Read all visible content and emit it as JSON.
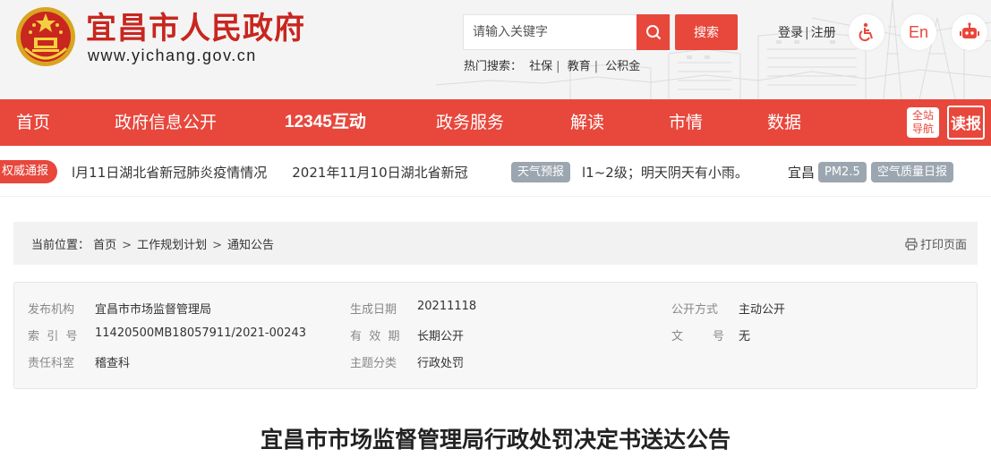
{
  "header": {
    "site_title": "宜昌市人民政府",
    "site_url": "www.yichang.gov.cn",
    "search_placeholder": "请输入关键字",
    "search_button": "搜索",
    "hot_label": "热门搜索：",
    "hot_terms": [
      "社保",
      "教育",
      "公积金"
    ],
    "login": "登录",
    "register": "注册",
    "lang_button": "En"
  },
  "nav": {
    "items": [
      "首页",
      "政府信息公开",
      "12345互动",
      "政务服务",
      "解读",
      "市情",
      "数据"
    ],
    "guide_line1": "全站",
    "guide_line2": "导航",
    "read_label": "读报"
  },
  "ticker": {
    "badge": "权威通报",
    "news": [
      "1月11日湖北省新冠肺炎疫情情况",
      "2021年11月10日湖北省新冠"
    ],
    "news_visible": [
      "l月11日湖北省新冠肺炎疫情情况",
      "2021年11月10日湖北省新冠"
    ],
    "weather_badge": "天气预报",
    "weather_text": "l1~2级；明天阴天有小雨。",
    "city_text": "宜昌",
    "pm_badge": "PM2.5",
    "aqi_badge": "空气质量日报"
  },
  "breadcrumb": {
    "prefix": "当前位置：",
    "items": [
      "首页",
      "工作规划计划",
      "通知公告"
    ],
    "separator": ">",
    "print_label": "打印页面"
  },
  "meta": {
    "publisher_label": "发布机构",
    "publisher": "宜昌市市场监督管理局",
    "date_label": "生成日期",
    "date": "20211118",
    "method_label": "公开方式",
    "method": "主动公开",
    "index_label": "索  引  号",
    "index": "11420500MB18057911/2021-00243",
    "valid_label": "有  效  期",
    "valid": "长期公开",
    "doc_label": "文        号",
    "doc": "无",
    "dept_label": "责任科室",
    "dept": "稽查科",
    "topic_label": "主题分类",
    "topic": "行政处罚"
  },
  "article": {
    "title": "宜昌市市场监督管理局行政处罚决定书送达公告"
  },
  "colors": {
    "brand_red": "#e8473c",
    "title_red": "#c8261f",
    "badge_gray": "#9ba6b0"
  }
}
